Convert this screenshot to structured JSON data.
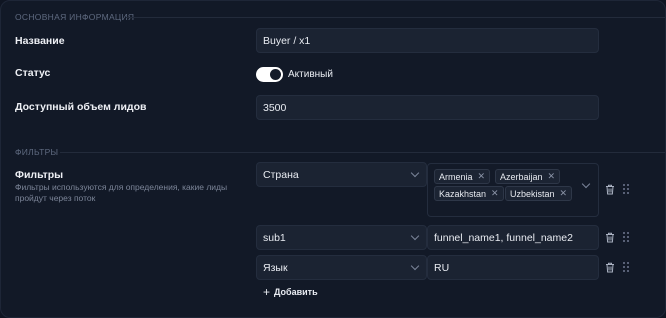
{
  "sections": {
    "basic": "ОСНОВНАЯ ИНФОРМАЦИЯ",
    "filters": "ФИЛЬТРЫ"
  },
  "fields": {
    "name_label": "Название",
    "name_value": "Buyer / x1",
    "status_label": "Статус",
    "status_value": "Активный",
    "status_on": true,
    "leads_label": "Доступный объем лидов",
    "leads_value": "3500"
  },
  "filters": {
    "label": "Фильтры",
    "hint": "Фильтры используются для определения, какие лиды пройдут через поток",
    "rows": [
      {
        "select": "Страна",
        "tags": [
          "Armenia",
          "Azerbaijan",
          "Kazakhstan",
          "Uzbekistan"
        ]
      },
      {
        "select": "sub1",
        "value": "funnel_name1, funnel_name2"
      },
      {
        "select": "Язык",
        "value": "RU"
      }
    ],
    "add_label": "Добавить"
  },
  "icons": {
    "remove_tag": "close-icon",
    "delete_row": "trash-icon",
    "drag_row": "drag-handle-icon",
    "dropdown": "chevron-down-icon",
    "add": "plus-icon"
  },
  "colors": {
    "background": "#121927",
    "input": "#1b2332",
    "accent": "#ffffff"
  }
}
